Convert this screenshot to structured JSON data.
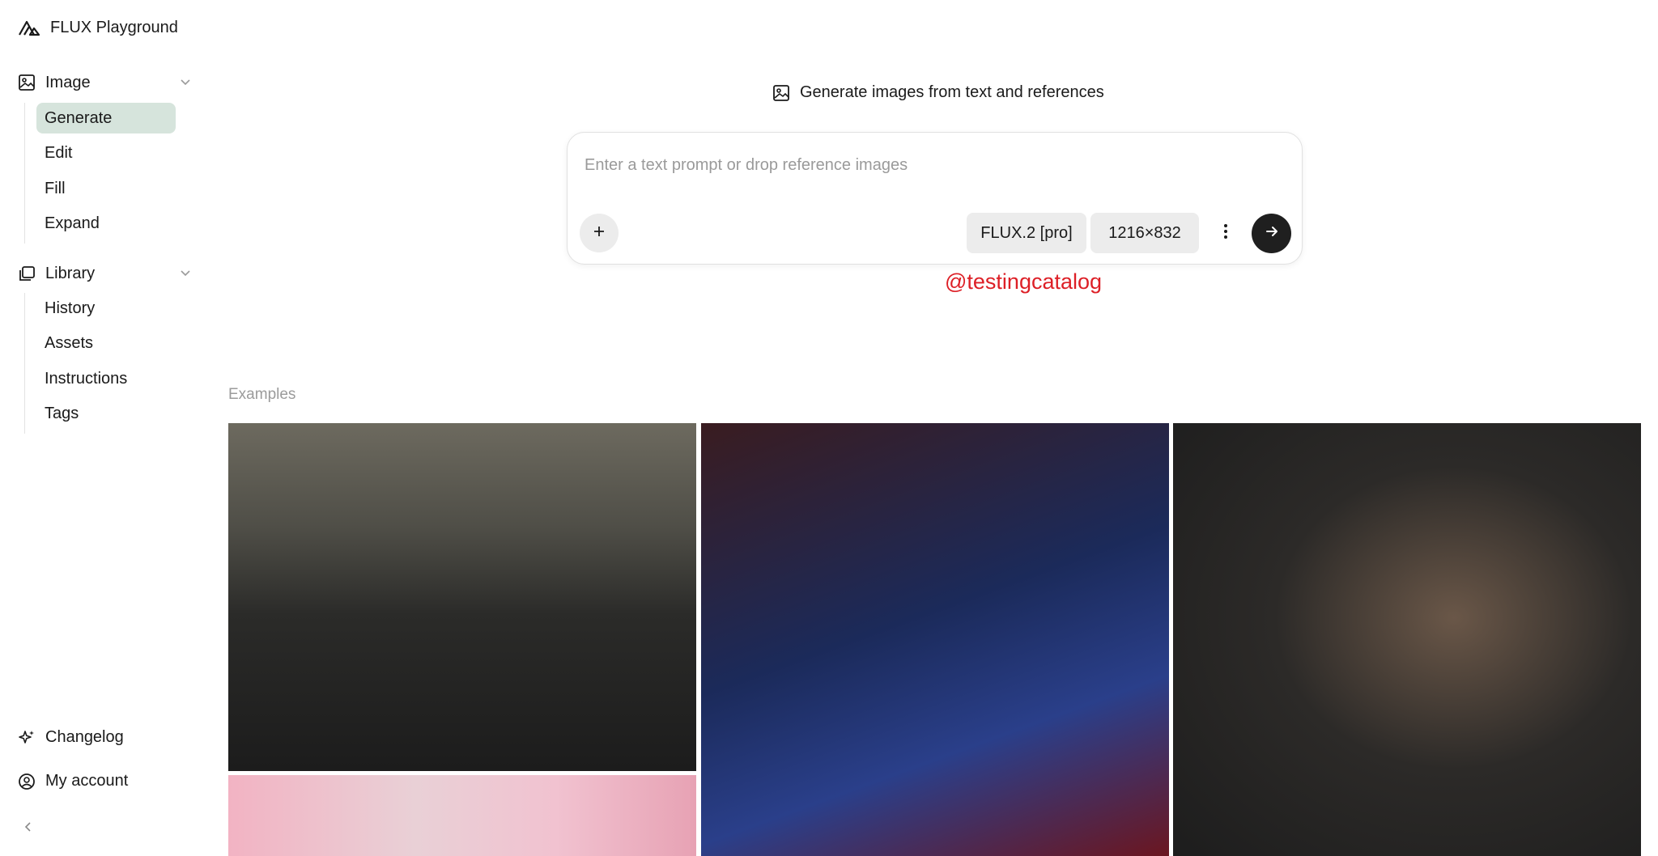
{
  "app": {
    "title": "FLUX Playground"
  },
  "sidebar": {
    "groups": [
      {
        "label": "Image",
        "icon": "image-icon",
        "items": [
          "Generate",
          "Edit",
          "Fill",
          "Expand"
        ],
        "active": "Generate"
      },
      {
        "label": "Library",
        "icon": "library-icon",
        "items": [
          "History",
          "Assets",
          "Instructions",
          "Tags"
        ]
      }
    ],
    "bottom": [
      {
        "label": "Changelog",
        "icon": "sparkle-icon"
      },
      {
        "label": "My account",
        "icon": "user-circle-icon"
      }
    ],
    "collapse_icon": "chevron-left-icon"
  },
  "main": {
    "heading": "Generate images from text and references",
    "prompt": {
      "placeholder": "Enter a text prompt or drop reference images",
      "value": "",
      "model": "FLUX.2 [pro]",
      "size": "1216×832"
    },
    "watermark": "@testingcatalog",
    "examples_label": "Examples"
  },
  "colors": {
    "active_bg": "#d6e4dc",
    "send_button": "#1f1f1f",
    "watermark": "#dd1f26",
    "muted_text": "#9b9b9b"
  }
}
